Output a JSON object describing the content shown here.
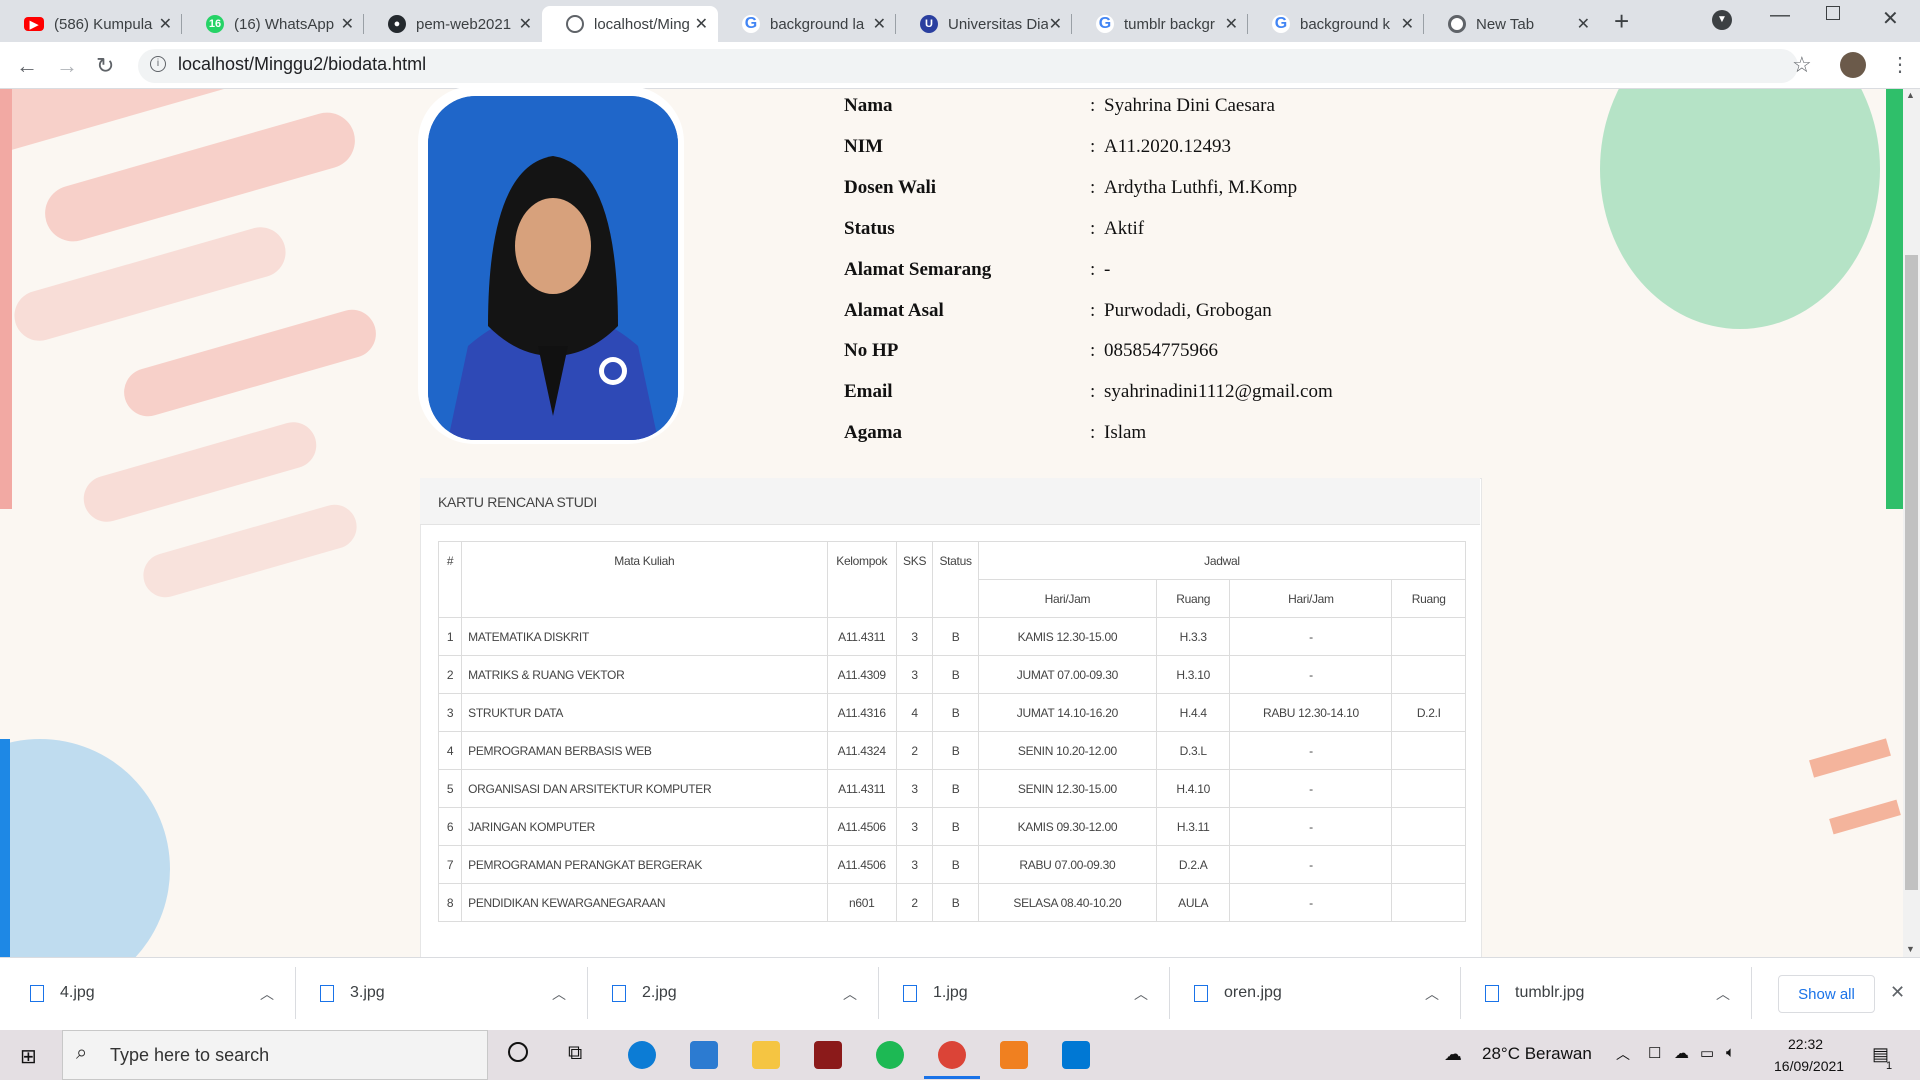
{
  "browser": {
    "tabs": [
      {
        "title": "(586) Kumpula",
        "favicon": "youtube-icon",
        "color": "#ff0000"
      },
      {
        "title": "(16) WhatsApp",
        "favicon": "whatsapp-icon",
        "color": "#25d366",
        "badge": "16"
      },
      {
        "title": "pem-web2021",
        "favicon": "github-icon",
        "color": "#24292e"
      },
      {
        "title": "localhost/Ming",
        "favicon": "globe-icon",
        "color": "#5f6368"
      },
      {
        "title": "background la",
        "favicon": "google-icon",
        "color": "#4285f4"
      },
      {
        "title": "Universitas Dia",
        "favicon": "udinus-icon",
        "color": "#2a3f9f"
      },
      {
        "title": "tumblr backgr",
        "favicon": "google-icon",
        "color": "#4285f4"
      },
      {
        "title": "background k",
        "favicon": "google-icon",
        "color": "#4285f4"
      },
      {
        "title": "New Tab",
        "favicon": "chrome-icon",
        "color": "#5f6368"
      }
    ],
    "url": "localhost/Minggu2/biodata.html"
  },
  "biodata": {
    "rows": [
      {
        "label": "Nama",
        "value": "Syahrina Dini Caesara"
      },
      {
        "label": "NIM",
        "value": "A11.2020.12493"
      },
      {
        "label": "Dosen Wali",
        "value": "Ardytha Luthfi, M.Komp"
      },
      {
        "label": "Status",
        "value": "Aktif"
      },
      {
        "label": "Alamat Semarang",
        "value": "-"
      },
      {
        "label": "Alamat Asal",
        "value": "Purwodadi, Grobogan"
      },
      {
        "label": "No HP",
        "value": "085854775966"
      },
      {
        "label": "Email",
        "value": "syahrinadini1112@gmail.com"
      },
      {
        "label": "Agama",
        "value": "Islam"
      }
    ],
    "separator": ":"
  },
  "krs": {
    "title": "KARTU RENCANA STUDI",
    "headers": {
      "no": "#",
      "matkul": "Mata Kuliah",
      "kelompok": "Kelompok",
      "sks": "SKS",
      "status": "Status",
      "jadwal": "Jadwal",
      "harijam1": "Hari/Jam",
      "ruang1": "Ruang",
      "harijam2": "Hari/Jam",
      "ruang2": "Ruang"
    },
    "rows": [
      [
        "1",
        "MATEMATIKA DISKRIT",
        "A11.4311",
        "3",
        "B",
        "KAMIS 12.30-15.00",
        "H.3.3",
        "-",
        ""
      ],
      [
        "2",
        "MATRIKS & RUANG VEKTOR",
        "A11.4309",
        "3",
        "B",
        "JUMAT 07.00-09.30",
        "H.3.10",
        "-",
        ""
      ],
      [
        "3",
        "STRUKTUR DATA",
        "A11.4316",
        "4",
        "B",
        "JUMAT 14.10-16.20",
        "H.4.4",
        "RABU 12.30-14.10",
        "D.2.I"
      ],
      [
        "4",
        "PEMROGRAMAN BERBASIS WEB",
        "A11.4324",
        "2",
        "B",
        "SENIN 10.20-12.00",
        "D.3.L",
        "-",
        ""
      ],
      [
        "5",
        "ORGANISASI DAN ARSITEKTUR KOMPUTER",
        "A11.4311",
        "3",
        "B",
        "SENIN 12.30-15.00",
        "H.4.10",
        "-",
        ""
      ],
      [
        "6",
        "JARINGAN KOMPUTER",
        "A11.4506",
        "3",
        "B",
        "KAMIS 09.30-12.00",
        "H.3.11",
        "-",
        ""
      ],
      [
        "7",
        "PEMROGRAMAN PERANGKAT BERGERAK",
        "A11.4506",
        "3",
        "B",
        "RABU 07.00-09.30",
        "D.2.A",
        "-",
        ""
      ],
      [
        "8",
        "PENDIDIKAN KEWARGANEGARAAN",
        "n601",
        "2",
        "B",
        "SELASA 08.40-10.20",
        "AULA",
        "-",
        ""
      ]
    ]
  },
  "downloads": {
    "items": [
      "4.jpg",
      "3.jpg",
      "2.jpg",
      "1.jpg",
      "oren.jpg",
      "tumblr.jpg"
    ],
    "show_all": "Show all"
  },
  "taskbar": {
    "search_placeholder": "Type here to search",
    "weather": "28°C  Berawan",
    "time": "22:32",
    "date": "16/09/2021",
    "notification_count": "1"
  }
}
